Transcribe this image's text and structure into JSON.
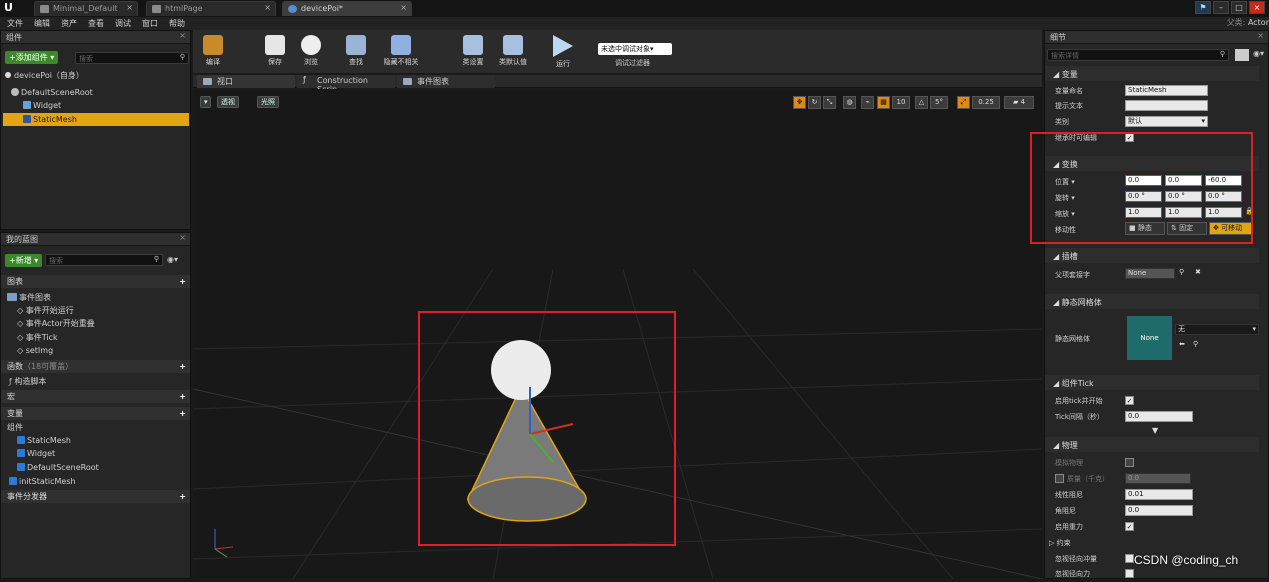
{
  "titlebar": {
    "tabs": [
      {
        "label": "Minimal_Default"
      },
      {
        "label": "htmlPage"
      },
      {
        "label": "devicePoi*"
      }
    ],
    "close_glyph": "×"
  },
  "menu": [
    "文件",
    "编辑",
    "资产",
    "查看",
    "调试",
    "窗口",
    "帮助"
  ],
  "parent_class": {
    "label": "父类:",
    "value": "Actor"
  },
  "components": {
    "title": "组件",
    "add_button": "+添加组件 ▾",
    "search_placeholder": "搜索",
    "self_item": "devicePoi（自身）",
    "tree": [
      {
        "label": "DefaultSceneRoot"
      },
      {
        "label": "Widget"
      },
      {
        "label": "StaticMesh"
      }
    ]
  },
  "my_blueprint": {
    "title": "我的蓝图",
    "new_button": "+新增 ▾",
    "search_placeholder": "搜索",
    "graphs_section": "图表",
    "event_graph": "事件图表",
    "events": [
      "事件开始运行",
      "事件Actor开始重叠",
      "事件Tick",
      "setImg"
    ],
    "functions_section": "函数",
    "functions_count": "（18可覆盖）",
    "construction_script": "构造脚本",
    "macros_section": "宏",
    "variables_section": "变量",
    "components_group": "组件",
    "component_vars": [
      "StaticMesh",
      "Widget",
      "DefaultSceneRoot"
    ],
    "init_static_mesh": "initStaticMesh",
    "event_dispatchers": "事件分发器"
  },
  "toolbar": {
    "buttons": [
      {
        "label": "编译"
      },
      {
        "label": "保存"
      },
      {
        "label": "浏览"
      },
      {
        "label": "查找"
      },
      {
        "label": "隐藏不相关"
      },
      {
        "label": "类设置"
      },
      {
        "label": "类默认值"
      },
      {
        "label": "运行"
      }
    ],
    "debug_select": "未选中调试对象▾",
    "debug_filter": "调试过滤器"
  },
  "viewport_tabs": [
    {
      "label": "视口"
    },
    {
      "label": "Construction Scrip"
    },
    {
      "label": "事件图表"
    }
  ],
  "viewport": {
    "perspective": "透视",
    "lit": "光照",
    "grid_snap": "10",
    "rot_snap": "5°",
    "scale_snap": "0.25",
    "cam_speed": "4"
  },
  "details": {
    "title": "细节",
    "search_placeholder": "搜索详情",
    "variable_section": "变量",
    "var_name_label": "变量命名",
    "var_name_value": "StaticMesh",
    "tooltip_label": "提示文本",
    "category_label": "类别",
    "category_value": "默认",
    "editable_label": "继承时可编辑",
    "transform_section": "变换",
    "location_label": "位置 ▾",
    "location": [
      "0.0",
      "0.0",
      "-60.0"
    ],
    "rotation_label": "旋转 ▾",
    "rotation": [
      "0.0 °",
      "0.0 °",
      "0.0 °"
    ],
    "scale_label": "缩放 ▾",
    "scale": [
      "1.0",
      "1.0",
      "1.0"
    ],
    "mobility_label": "移动性",
    "mobility": [
      "静态",
      "固定",
      "可移动"
    ],
    "sockets_section": "插槽",
    "parent_socket_label": "父项套接字",
    "parent_socket_value": "None",
    "static_mesh_section": "静态网格体",
    "static_mesh_label": "静态网格体",
    "static_mesh_thumb": "None",
    "static_mesh_value": "无",
    "tick_section": "组件Tick",
    "tick_start_label": "启用tick并开始",
    "tick_interval_label": "Tick间隔（秒）",
    "tick_interval_value": "0.0",
    "physics_section": "物理",
    "simulate_label": "模拟物理",
    "mass_label": "质量（千克）",
    "mass_value": "0.0",
    "linear_damping_label": "线性阻尼",
    "linear_damping_value": "0.01",
    "angular_damping_label": "角阻尼",
    "angular_damping_value": "0.0",
    "gravity_label": "启用重力",
    "constraints_label": "约束",
    "ignore_radial_impulse": "忽视径向冲量",
    "ignore_radial_force": "忽视径向力"
  },
  "watermark": "CSDN @coding_ch",
  "colors": {
    "accent": "#e1a513",
    "highlight": "#e02020",
    "green_btn": "#3a8a2a"
  }
}
